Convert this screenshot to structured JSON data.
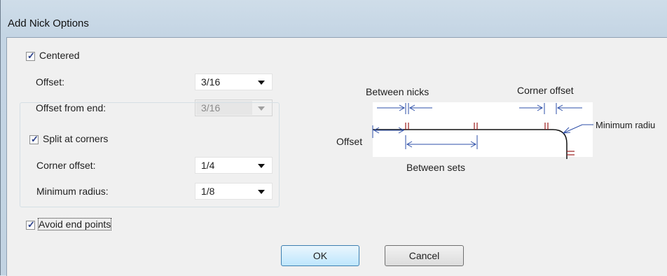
{
  "window": {
    "title": "Add Nick Options"
  },
  "options": {
    "centered": {
      "label": "Centered",
      "checked": true
    },
    "offset": {
      "label": "Offset:",
      "value": "3/16"
    },
    "offset_from_end": {
      "label": "Offset from end:",
      "value": "3/16",
      "disabled": true
    },
    "split_at_corners": {
      "label": "Split at corners",
      "checked": true
    },
    "corner_offset": {
      "label": "Corner offset:",
      "value": "1/4"
    },
    "minimum_radius": {
      "label": "Minimum radius:",
      "value": "1/8"
    },
    "avoid_end_points": {
      "label": "Avoid end points",
      "checked": true
    }
  },
  "diagram": {
    "between_nicks": "Between nicks",
    "corner_offset": "Corner offset",
    "minimum_radius": "Minimum radiu",
    "offset": "Offset",
    "between_sets": "Between sets"
  },
  "buttons": {
    "ok": "OK",
    "cancel": "Cancel"
  },
  "colors": {
    "arrow": "#2e4fa8",
    "nick": "#9b1c1c",
    "line": "#111111"
  }
}
